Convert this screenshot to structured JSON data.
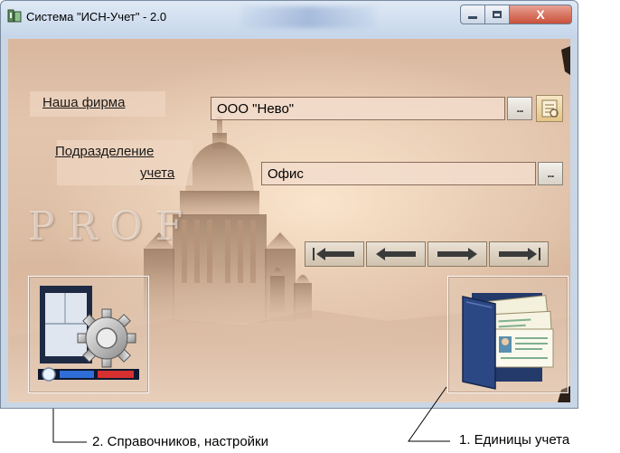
{
  "window": {
    "title": "Система \"ИСН-Учет\" - 2.0",
    "buttons": {
      "minimize": "▭",
      "maximize": "□",
      "close": "X"
    }
  },
  "watermark": "PROF",
  "form": {
    "firm": {
      "label": "Наша фирма",
      "value": "ООО \"Нево\""
    },
    "department": {
      "label_line1": "Подразделение",
      "label_line2": "учета",
      "value": "Офис"
    },
    "dots_label": "..."
  },
  "navigation": {
    "icons": [
      "first-record-icon",
      "previous-record-icon",
      "next-record-icon",
      "last-record-icon"
    ]
  },
  "tiles": {
    "settings": {
      "icon": "settings-panel-gear-icon"
    },
    "units": {
      "icon": "folder-cards-icon"
    }
  },
  "captions": {
    "settings": "2. Справочников, настройки",
    "units": "1. Единицы учета"
  },
  "colors": {
    "sepia_bg": "#dcbda4",
    "field_bg": "#f2dccb",
    "close_red": "#c9503a"
  }
}
